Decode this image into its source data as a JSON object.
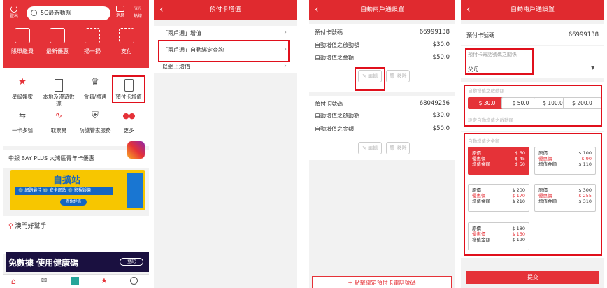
{
  "panel1": {
    "logout": "登出",
    "search_placeholder": "5G最新動態",
    "messages": "消息",
    "hotline": "熱線",
    "quick_actions": [
      "賬單繳費",
      "最新優惠",
      "掃一掃",
      "支付"
    ],
    "grid": [
      "星級娛家",
      "本地及漫遊數據",
      "會籍/禮遇",
      "預付卡增值",
      "一卡多號",
      "取票易",
      "防護管家服務",
      "更多"
    ],
    "promo_text": "中銀 BAY PLUS 大灣區青年卡優惠",
    "banner_title": "自擴站",
    "banner_sub": "⚙️ 網路最佳 ⚙️ 安全網站 ⚙️ 影視娛樂",
    "banner_btn": "查詢詳情",
    "helper_title": "澳門好幫手",
    "health_banner": "免數據 使用健康碼",
    "health_btn": "登記"
  },
  "panel2": {
    "title": "預付卡增值",
    "items": [
      "「兩戶通」增值",
      "「兩戶通」自動綁定查詢",
      "以網上增值"
    ]
  },
  "panel3": {
    "title": "自動兩戶通設置",
    "cards": [
      {
        "label": "預付卡號碼",
        "number": "66999138",
        "trigger_label": "自動增值之啟動額",
        "trigger": "$30.0",
        "amount_label": "自動增值之金額",
        "amount": "$50.0"
      },
      {
        "label": "預付卡號碼",
        "number": "68049256",
        "trigger_label": "自動增值之啟動額",
        "trigger": "$30.0",
        "amount_label": "自動增值之金額",
        "amount": "$50.0"
      }
    ],
    "edit": "編輯",
    "remove": "移除",
    "bind": "+ 點擊綁定預付卡電話號碼"
  },
  "panel4": {
    "title": "自動兩戶通設置",
    "card_label": "預付卡號碼",
    "card_number": "66999138",
    "relation_label": "預付卡電話號碼之關係",
    "relation_value": "父母",
    "trigger_label": "自動增值之啟動額",
    "amounts": [
      "$ 30.0",
      "$ 50.0",
      "$ 100.0",
      "$ 200.0"
    ],
    "hint": "設定自動增值之啟動額",
    "package_label": "自動增值之金額",
    "packages": [
      {
        "orig": "$ 50",
        "disc": "$ 45",
        "total": "$ 50"
      },
      {
        "orig": "$ 100",
        "disc": "$ 90",
        "total": "$ 110"
      },
      {
        "orig": "$ 200",
        "disc": "$ 170",
        "total": "$ 210"
      },
      {
        "orig": "$ 300",
        "disc": "$ 255",
        "total": "$ 310"
      },
      {
        "orig": "$ 180",
        "disc": "$ 150",
        "total": "$ 190"
      }
    ],
    "orig_label": "原價",
    "disc_label": "優惠價",
    "total_label": "增值金額",
    "submit": "提交"
  }
}
